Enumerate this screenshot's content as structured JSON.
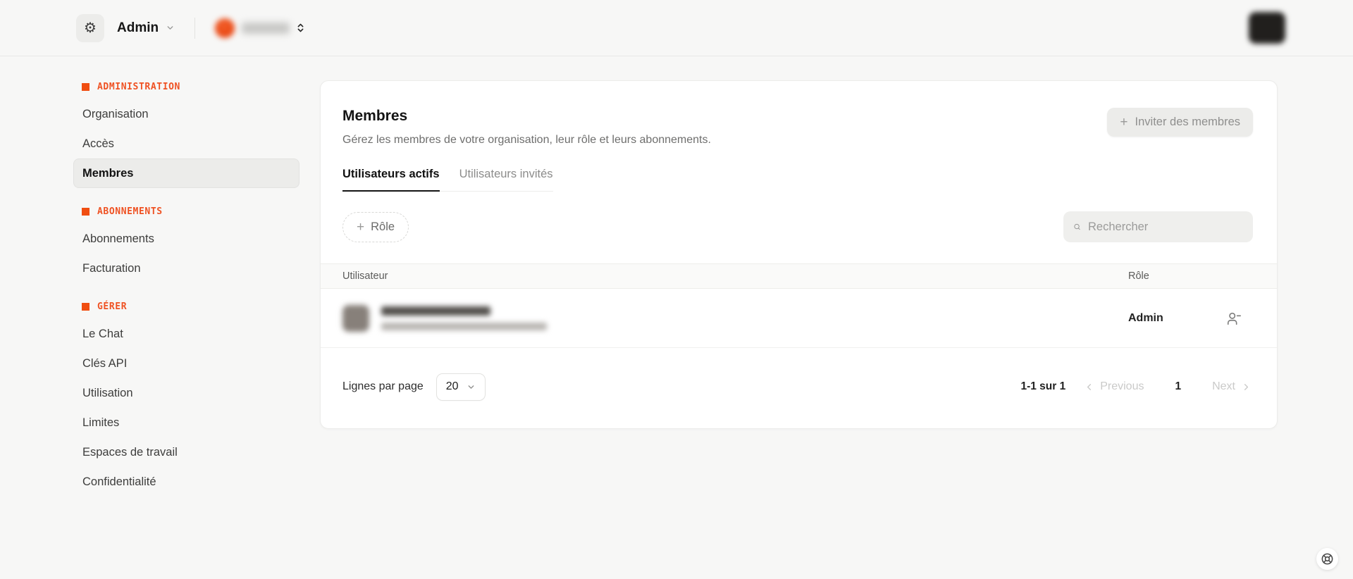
{
  "colors": {
    "accent_square": "#f04e11",
    "accent_text": "#ef5223",
    "page_bg": "#f7f7f6",
    "card_bg": "#ffffff",
    "selected_item_bg": "#ececea"
  },
  "header": {
    "admin_label": "Admin"
  },
  "sidebar": {
    "groups": [
      {
        "title": "ADMINISTRATION",
        "items": [
          {
            "label": "Organisation",
            "active": false
          },
          {
            "label": "Accès",
            "active": false
          },
          {
            "label": "Membres",
            "active": true
          }
        ]
      },
      {
        "title": "ABONNEMENTS",
        "items": [
          {
            "label": "Abonnements",
            "active": false
          },
          {
            "label": "Facturation",
            "active": false
          }
        ]
      },
      {
        "title": "GÉRER",
        "items": [
          {
            "label": "Le Chat",
            "active": false
          },
          {
            "label": "Clés API",
            "active": false
          },
          {
            "label": "Utilisation",
            "active": false
          },
          {
            "label": "Limites",
            "active": false
          },
          {
            "label": "Espaces de travail",
            "active": false
          },
          {
            "label": "Confidentialité",
            "active": false
          }
        ]
      }
    ]
  },
  "main": {
    "title": "Membres",
    "subtitle": "Gérez les membres de votre organisation, leur rôle et leurs abonnements.",
    "invite_button": "Inviter des membres",
    "tabs": [
      {
        "label": "Utilisateurs actifs",
        "active": true
      },
      {
        "label": "Utilisateurs invités",
        "active": false
      }
    ],
    "role_filter_button": "Rôle",
    "search_placeholder": "Rechercher",
    "table": {
      "columns": [
        "Utilisateur",
        "Rôle"
      ],
      "rows": [
        {
          "role": "Admin"
        }
      ]
    },
    "pagination": {
      "rows_per_page_label": "Lignes par page",
      "rows_per_page_value": "20",
      "range_label": "1-1 sur 1",
      "previous_label": "Previous",
      "page_number": "1",
      "next_label": "Next"
    }
  },
  "icons": {
    "gear": "⚙",
    "plus": "+",
    "chevron_down": "chevron-down",
    "chevrons_up_down": "chevrons-up-down",
    "search": "magnifier",
    "user_minus": "user-minus",
    "chevron_left": "chevron-left",
    "chevron_right": "chevron-right",
    "lifebuoy": "lifebuoy"
  }
}
